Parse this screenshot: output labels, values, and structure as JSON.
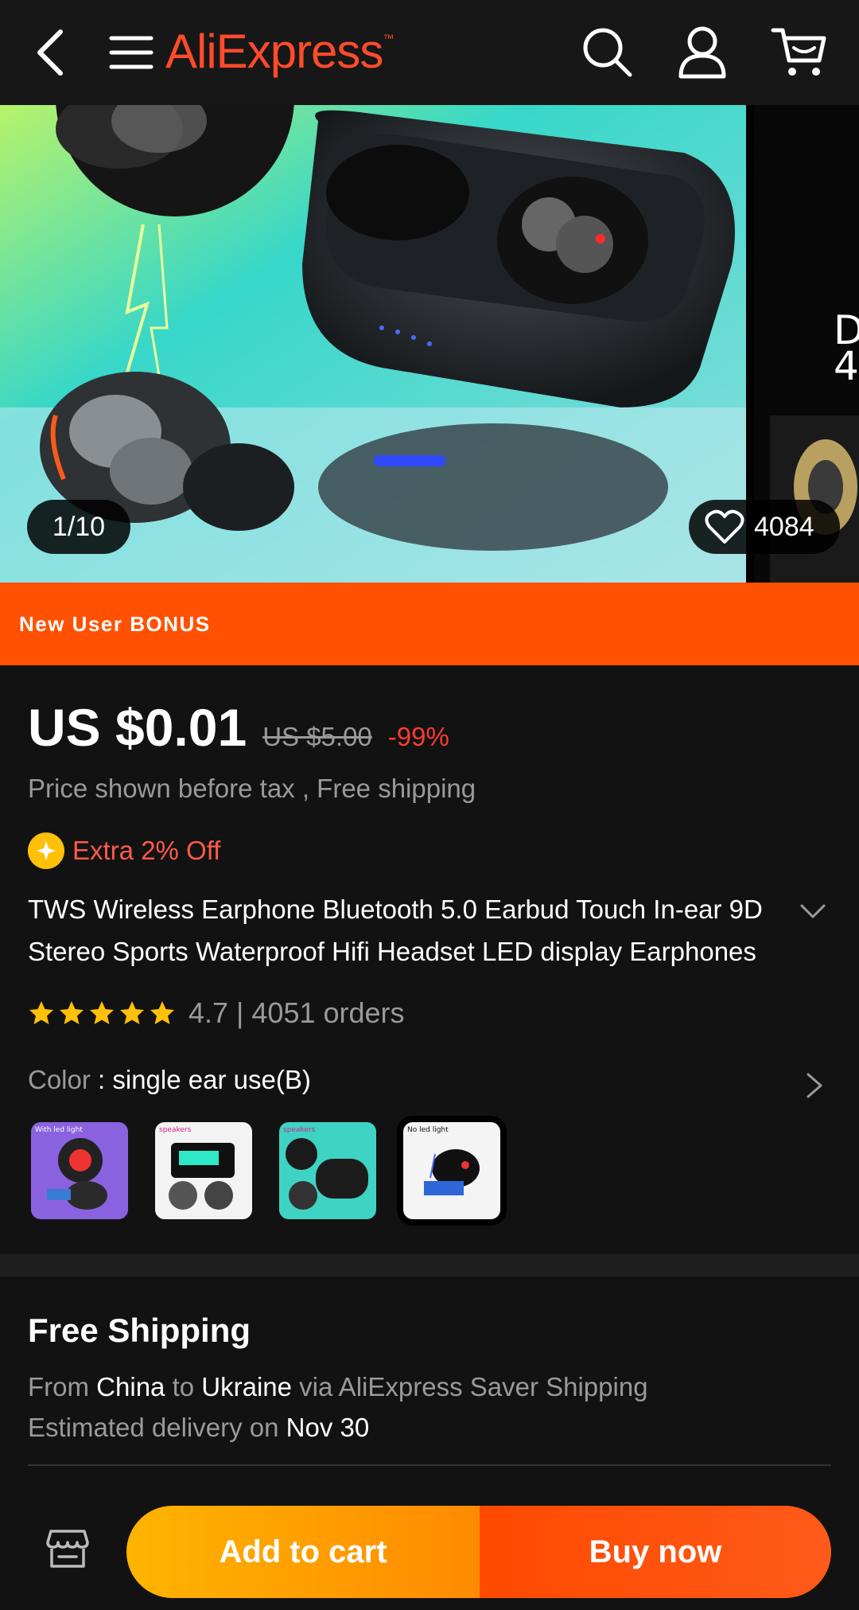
{
  "header": {
    "logo": "AliExpress",
    "logo_tm": "™",
    "icons": [
      "back-icon",
      "menu-icon",
      "search-icon",
      "user-icon",
      "cart-icon"
    ]
  },
  "gallery": {
    "counter": "1/10",
    "favorites": "4084"
  },
  "bonus": {
    "label": "New User BONUS",
    "color": "#ff5101"
  },
  "product": {
    "price": "US $0.01",
    "original_price": "US $5.00",
    "discount": "-99%",
    "tax_note": "Price shown before tax , Free shipping",
    "extra_off": "Extra 2% Off",
    "title": "TWS Wireless Earphone Bluetooth 5.0 Earbud Touch In-ear 9D Stereo Sports Waterproof Hifi Headset LED display Earphones",
    "rating": 4.7,
    "rating_text": "4.7 | 4051 orders",
    "color_label": "Color",
    "color_value": " : single ear use(B)",
    "variants": [
      {
        "caption": "With led light",
        "selected": false
      },
      {
        "caption": "speakers",
        "selected": false
      },
      {
        "caption": "speakers",
        "selected": false
      },
      {
        "caption": "No led light",
        "selected": true
      }
    ]
  },
  "shipping": {
    "title": "Free Shipping",
    "from_label": "From ",
    "from": "China",
    "to_label": " to ",
    "to": "Ukraine",
    "via": " via AliExpress Saver Shipping",
    "eta_label": "Estimated delivery on ",
    "eta": "Nov 30"
  },
  "actions": {
    "add_to_cart": "Add to cart",
    "buy_now": "Buy now"
  },
  "colors": {
    "brand": "#ff4b2b",
    "discount": "#ff3b30",
    "add_cart_start": "#ffb400",
    "buy_now": "#ff4a00"
  }
}
